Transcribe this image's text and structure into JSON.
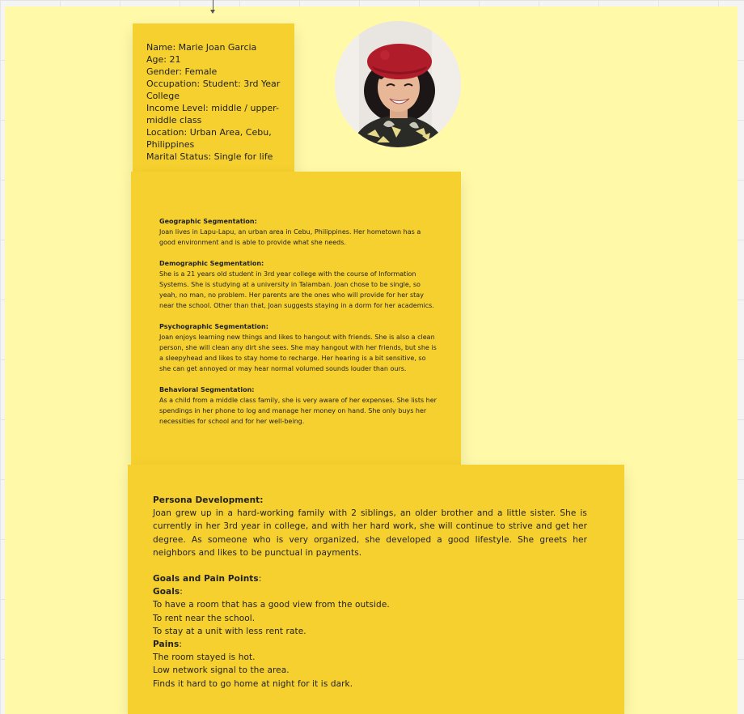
{
  "persona": {
    "profile": [
      "Name: Marie Joan Garcia",
      "Age: 21",
      "Gender: Female",
      "Occupation: Student: 3rd Year College",
      "Income Level: middle / upper-middle class",
      "Location: Urban Area, Cebu, Philippines",
      "Marital Status: Single for life"
    ]
  },
  "segmentation": [
    {
      "title": "Geographic Segmentation:",
      "text": "Joan lives in Lapu-Lapu, an urban area in Cebu, Philippines. Her hometown has a good environment and is able to provide what she needs."
    },
    {
      "title": "Demographic Segmentation:",
      "text": "She is a 21 years old student in 3rd year college with the course of Information Systems.  She is studying at a university in Talamban. Joan chose to be single, so yeah, no man, no problem. Her parents are the ones who will provide for her stay near the school. Other than that, Joan suggests staying in a dorm for her academics."
    },
    {
      "title": "Psychographic Segmentation:",
      "text": "Joan enjoys learning new things and likes to hangout with friends. She is also  a clean person, she will clean any dirt she sees. She may hangout with her friends, but she is a sleepyhead and likes to stay home to recharge. Her hearing is a bit sensitive, so she can get annoyed or may hear normal volumed sounds louder than ours."
    },
    {
      "title": "Behavioral Segmentation:",
      "text": "As a child from a middle class family, she is very aware of her expenses. She lists her spendings in her phone to log and manage her money on hand. She only buys her necessities for school and for her well-being."
    }
  ],
  "development": {
    "title": "Persona Development:",
    "text": "Joan grew up in a hard-working family with 2 siblings, an older brother and a little sister. She is currently in her 3rd year in college, and with her hard work, she will continue to strive and get her degree. As someone who is very organized, she developed a good lifestyle. She greets her neighbors and likes to be punctual in payments.",
    "goals_pains_title": "Goals and Pain Points",
    "goals_pains_colon": ":",
    "goals_title": "Goals",
    "goals_colon": ":",
    "goals": [
      "To have a room that has a good view from the outside.",
      "To rent near the school.",
      "To stay at a unit with less rent rate."
    ],
    "pains_title": "Pains",
    "pains_colon": ":",
    "pains": [
      "The room stayed is hot.",
      "Low network signal to the area.",
      "Finds it hard to go home at night for it is dark."
    ]
  },
  "colors": {
    "background": "#fff9a8",
    "sticky_note": "#f6d02e",
    "beret": "#b01c2a"
  }
}
